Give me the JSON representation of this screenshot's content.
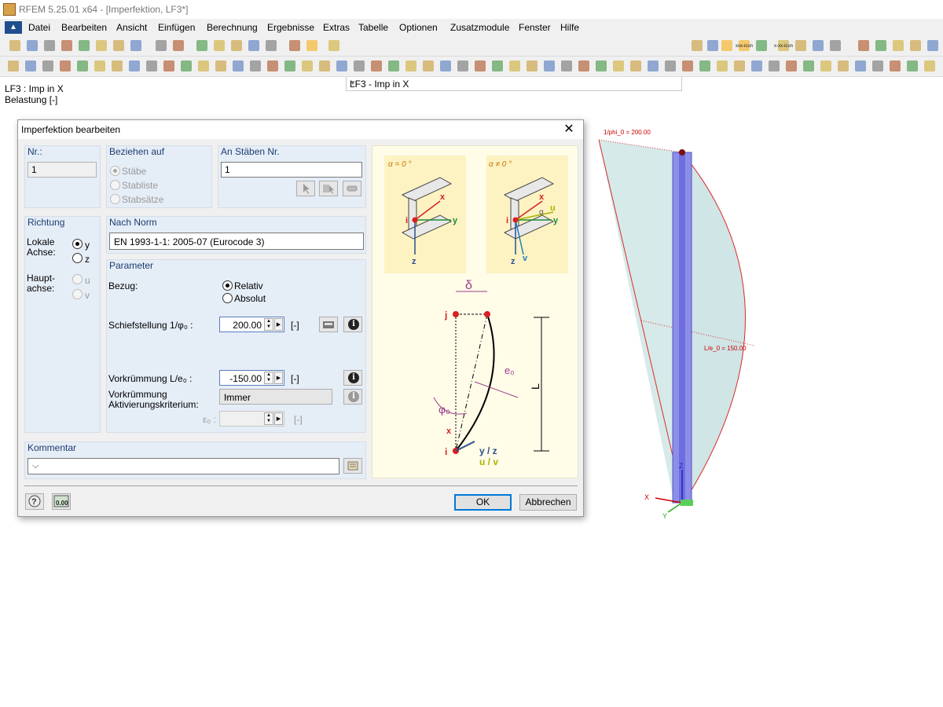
{
  "window": {
    "title": "RFEM 5.25.01 x64 - [Imperfektion, LF3*]"
  },
  "menu": [
    "Datei",
    "Bearbeiten",
    "Ansicht",
    "Einfügen",
    "Berechnung",
    "Ergebnisse",
    "Extras",
    "Tabelle",
    "Optionen",
    "Zusatzmodule",
    "Fenster",
    "Hilfe"
  ],
  "toolbar": {
    "load_case": "LF3 - Imp in X",
    "bar_icons": [
      "xxx-icon",
      "x-xx-icon"
    ]
  },
  "info": {
    "line1": "LF3 : Imp in X",
    "line2": "Belastung [-]"
  },
  "dialog": {
    "title": "Imperfektion bearbeiten",
    "nr": {
      "label": "Nr.:",
      "value": "1"
    },
    "beziehen": {
      "label": "Beziehen auf",
      "options": [
        "Stäbe",
        "Stabliste",
        "Stabsätze"
      ]
    },
    "staebe": {
      "label": "An Stäben Nr.",
      "value": "1"
    },
    "richtung": {
      "label": "Richtung",
      "lokale": "Lokale\nAchse:",
      "y": "y",
      "z": "z",
      "haupt": "Haupt-\nachse:",
      "u": "u",
      "v": "v"
    },
    "norm": {
      "label": "Nach Norm",
      "value": "EN 1993-1-1: 2005-07  (Eurocode 3)"
    },
    "parameter": {
      "label": "Parameter",
      "bezug": "Bezug:",
      "relativ": "Relativ",
      "absolut": "Absolut",
      "schief_label": "Schiefstellung 1/φ₀ :",
      "schief_value": "200.00",
      "unit": "[-]",
      "vork_label": "Vorkrümmung L/e₀ :",
      "vork_value": "-150.00",
      "aktiv_label": "Vorkrümmung\nAktivierungskriterium:",
      "aktiv_value": "Immer",
      "e0_label": "ε₀ :",
      "e0_value": ""
    },
    "kommentar": {
      "label": "Kommentar",
      "value": ""
    },
    "ok": "OK",
    "abbrechen": "Abbrechen",
    "figure": {
      "alpha0": "α = 0 °",
      "alphaNe": "α ≠ 0 °",
      "delta": "δ",
      "e0": "e₀",
      "phi0": "φ₀",
      "L": "L",
      "axis_labels": [
        "x",
        "y",
        "z",
        "i",
        "j",
        "u",
        "v",
        "α"
      ],
      "yz": "y / z",
      "uv": "u / v"
    }
  },
  "model": {
    "phi_label": "1/phi_0 = 200.00",
    "e_label": "L/e_0 = 150.00",
    "axes": [
      "X",
      "Y",
      "Z"
    ]
  }
}
